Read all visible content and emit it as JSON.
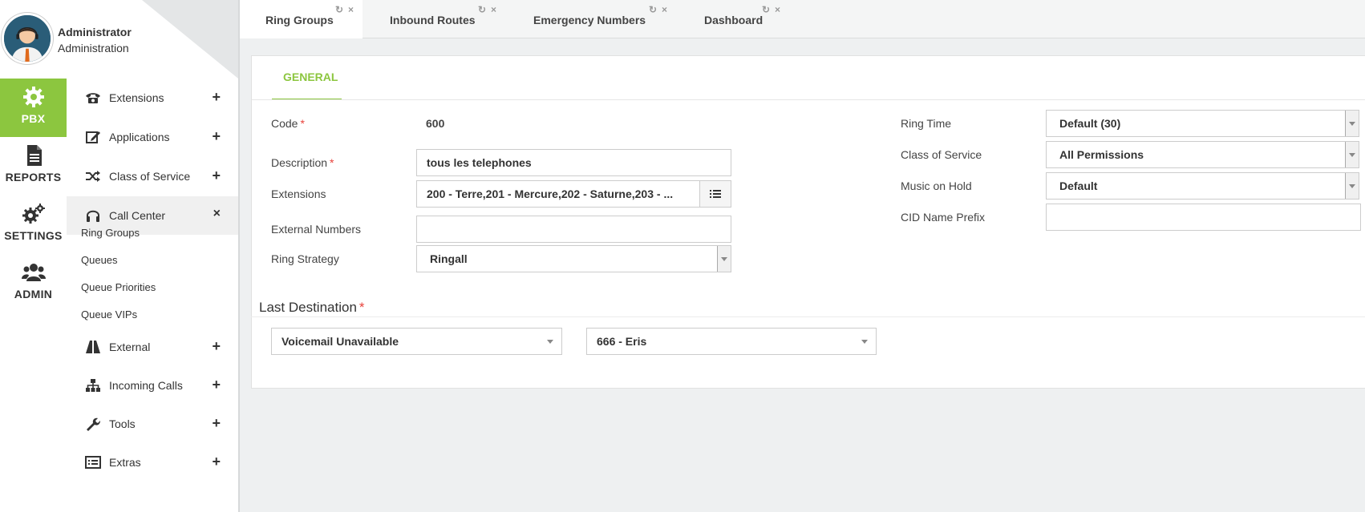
{
  "user": {
    "name": "Administrator",
    "role": "Administration"
  },
  "rail": [
    {
      "label": "PBX",
      "icon": "gear-icon",
      "active": true
    },
    {
      "label": "REPORTS",
      "icon": "document-icon",
      "active": false
    },
    {
      "label": "SETTINGS",
      "icon": "gears-icon",
      "active": false
    },
    {
      "label": "ADMIN",
      "icon": "users-icon",
      "active": false
    }
  ],
  "menu": {
    "extensions": {
      "label": "Extensions",
      "toggle": "+"
    },
    "applications": {
      "label": "Applications",
      "toggle": "+"
    },
    "class_of_service": {
      "label": "Class of Service",
      "toggle": "+"
    },
    "call_center": {
      "label": "Call Center",
      "toggle": "×"
    },
    "call_center_items": [
      "Ring Groups",
      "Queues",
      "Queue Priorities",
      "Queue VIPs"
    ],
    "external": {
      "label": "External",
      "toggle": "+"
    },
    "incoming_calls": {
      "label": "Incoming Calls",
      "toggle": "+"
    },
    "tools": {
      "label": "Tools",
      "toggle": "+"
    },
    "extras": {
      "label": "Extras",
      "toggle": "+"
    }
  },
  "tabs": [
    {
      "label": "Ring Groups",
      "active": true
    },
    {
      "label": "Inbound Routes",
      "active": false
    },
    {
      "label": "Emergency Numbers",
      "active": false
    },
    {
      "label": "Dashboard",
      "active": false
    }
  ],
  "tab_controls": {
    "refresh": "↻",
    "close": "×"
  },
  "form": {
    "subtab": "GENERAL",
    "code": {
      "label": "Code",
      "required": "*",
      "value": "600"
    },
    "description": {
      "label": "Description",
      "required": "*",
      "value": "tous les telephones"
    },
    "extensions": {
      "label": "Extensions",
      "value": "200 - Terre,201 - Mercure,202 - Saturne,203 - ..."
    },
    "external_numbers": {
      "label": "External Numbers",
      "value": ""
    },
    "ring_strategy": {
      "label": "Ring Strategy",
      "value": "Ringall"
    },
    "ring_time": {
      "label": "Ring Time",
      "value": "Default (30)"
    },
    "class_of_service": {
      "label": "Class of Service",
      "value": "All Permissions"
    },
    "music_on_hold": {
      "label": "Music on Hold",
      "value": "Default"
    },
    "cid_name_prefix": {
      "label": "CID Name Prefix",
      "value": ""
    },
    "last_destination": {
      "label": "Last Destination",
      "required": "*",
      "type_value": "Voicemail Unavailable",
      "target_value": "666 - Eris"
    }
  },
  "colors": {
    "accent": "#8cc63f",
    "required": "#e8423b",
    "avatar_bg": "#2a5d78"
  }
}
